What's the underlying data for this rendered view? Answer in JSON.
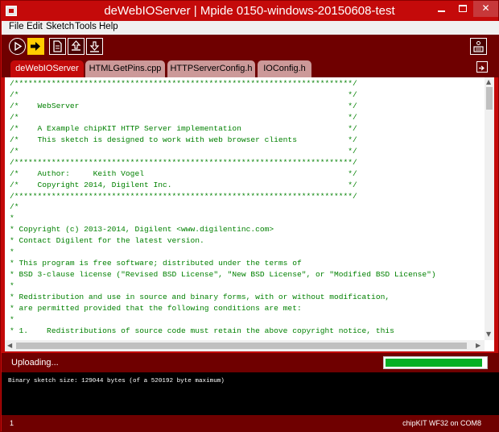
{
  "window": {
    "title": "deWebIOServer | Mpide 0150-windows-20150608-test",
    "close_glyph": "✕"
  },
  "menu": [
    "File",
    "Edit",
    "Sketch",
    "Tools",
    "Help"
  ],
  "toolbar": {
    "buttons": [
      "verify-icon",
      "upload-icon",
      "new-icon",
      "open-icon",
      "save-icon",
      "serial-monitor-icon"
    ],
    "accent": "#ffcc00"
  },
  "tabs": [
    "deWebIOServer",
    "HTMLGetPins.cpp",
    "HTTPServerConfig.h",
    "IOConfig.h"
  ],
  "editor": {
    "lines": [
      "/*************************************************************************/",
      "/*                                                                       */",
      "/*    WebServer                                                          */",
      "/*                                                                       */",
      "/*    A Example chipKIT HTTP Server implementation                       */",
      "/*    This sketch is designed to work with web browser clients           */",
      "/*                                                                       */",
      "/*************************************************************************/",
      "/*    Author:     Keith Vogel                                            */",
      "/*    Copyright 2014, Digilent Inc.                                      */",
      "/*************************************************************************/",
      "/*",
      "*",
      "* Copyright (c) 2013-2014, Digilent <www.digilentinc.com>",
      "* Contact Digilent for the latest version.",
      "*",
      "* This program is free software; distributed under the terms of",
      "* BSD 3-clause license (\"Revised BSD License\", \"New BSD License\", or \"Modified BSD License\")",
      "*",
      "* Redistribution and use in source and binary forms, with or without modification,",
      "* are permitted provided that the following conditions are met:",
      "*",
      "* 1.    Redistributions of source code must retain the above copyright notice, this"
    ],
    "text_color": "#008000"
  },
  "status": {
    "message": "Uploading...",
    "progress": 0.97,
    "progress_color": "#06b025"
  },
  "console": {
    "text": "Binary sketch size: 129044 bytes (of a 520192 byte maximum)"
  },
  "footer": {
    "line_number": "1",
    "board": "chipKIT WF32 on COM8"
  },
  "colors": {
    "frame": "#c40a0a",
    "toolbar": "#6f0000"
  }
}
